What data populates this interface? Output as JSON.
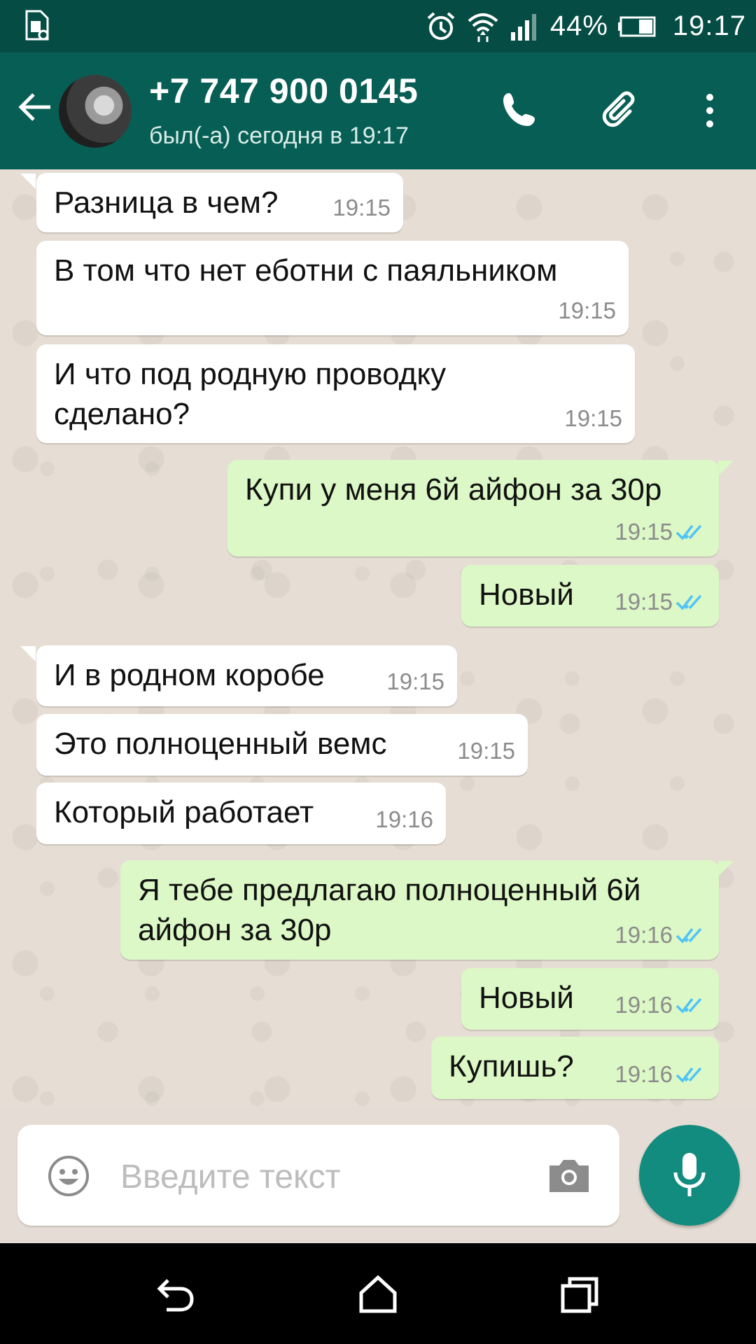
{
  "status_bar": {
    "battery": "44%",
    "time": "19:17"
  },
  "header": {
    "contact_name": "+7 747 900 0145",
    "last_seen": "был(-а) сегодня в 19:17"
  },
  "messages": [
    {
      "dir": "in",
      "lines": [
        "Разница в чем?"
      ],
      "time": "19:15"
    },
    {
      "dir": "in",
      "lines": [
        "В том что нет еботни с паяльником"
      ],
      "time": "19:15"
    },
    {
      "dir": "in",
      "lines": [
        "И что под родную проводку",
        "сделано?"
      ],
      "time": "19:15"
    },
    {
      "dir": "out",
      "lines": [
        "Купи у меня 6й айфон за 30р"
      ],
      "time": "19:15",
      "status": "read"
    },
    {
      "dir": "out",
      "lines": [
        "Новый"
      ],
      "time": "19:15",
      "status": "read"
    },
    {
      "dir": "in",
      "lines": [
        "И в родном коробе"
      ],
      "time": "19:15"
    },
    {
      "dir": "in",
      "lines": [
        "Это полноценный вемс"
      ],
      "time": "19:15"
    },
    {
      "dir": "in",
      "lines": [
        "Который работает"
      ],
      "time": "19:16"
    },
    {
      "dir": "out",
      "lines": [
        "Я тебе предлагаю полноценный 6й",
        "айфон за 30р"
      ],
      "time": "19:16",
      "status": "read"
    },
    {
      "dir": "out",
      "lines": [
        "Новый"
      ],
      "time": "19:16",
      "status": "read"
    },
    {
      "dir": "out",
      "lines": [
        "Купишь?"
      ],
      "time": "19:16",
      "status": "read"
    }
  ],
  "composer": {
    "placeholder": "Введите текст"
  },
  "colors": {
    "header": "#075e54",
    "status_bar": "#054d44",
    "outgoing_bubble": "#dcf8c6",
    "incoming_bubble": "#ffffff",
    "accent": "#128c7e",
    "read_ticks": "#4fc3f7"
  },
  "icons": [
    "back-arrow-icon",
    "phone-icon",
    "paperclip-icon",
    "more-vert-icon",
    "emoji-icon",
    "camera-icon",
    "mic-icon",
    "nav-back-icon",
    "nav-home-icon",
    "nav-recents-icon"
  ]
}
